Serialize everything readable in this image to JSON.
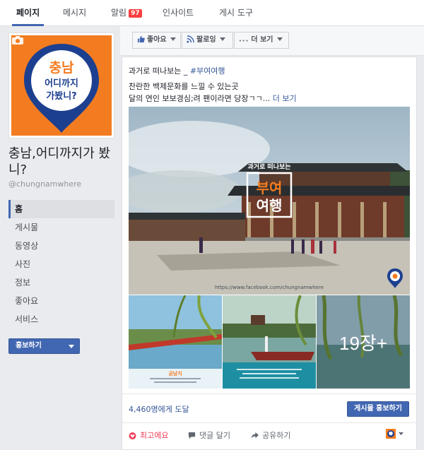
{
  "tabs": [
    {
      "label": "페이지",
      "active": true
    },
    {
      "label": "메시지",
      "active": false
    },
    {
      "label": "알림",
      "badge": "97",
      "active": false
    },
    {
      "label": "인사이트",
      "active": false
    },
    {
      "label": "게시 도구",
      "active": false
    }
  ],
  "sidebar": {
    "cover_text": [
      "충남",
      "어디까지",
      "가봤니?"
    ],
    "page_name": "충남,어디까지가 봤니?",
    "handle": "@chungnamwhere",
    "nav": [
      {
        "label": "홈",
        "active": true
      },
      {
        "label": "게시물",
        "active": false
      },
      {
        "label": "동영상",
        "active": false
      },
      {
        "label": "사진",
        "active": false
      },
      {
        "label": "정보",
        "active": false
      },
      {
        "label": "좋아요",
        "active": false
      },
      {
        "label": "서비스",
        "active": false
      }
    ],
    "promote_label": "홍보하기"
  },
  "actionbar": {
    "like": "좋아요",
    "follow": "팔로잉",
    "more": "더 보기"
  },
  "post": {
    "title_prefix": "과거로 떠나보는 _ ",
    "hashtag": "#부여여행",
    "line1": "찬란한 백제문화를 느낄 수 있는곳",
    "line2": "달의 연인 보보경심;려 팬이라면 당장ㄱㄱ...",
    "see_more": "더 보기",
    "image_overlay": {
      "subtitle": "과거로 떠나보는",
      "title_top": "부여",
      "title_bottom": "여행",
      "url": "https://www.facebook.com/chungnamwhere"
    },
    "thumb1_caption": "궁남지",
    "more_photos": "19장+",
    "reach": "4,460명에게 도달",
    "promote_post": "게시물 홍보하기",
    "actions": {
      "love": "최고에요",
      "comment": "댓글 달기",
      "share": "공유하기"
    }
  },
  "colors": {
    "brand_blue": "#4267b2",
    "link_blue": "#365899",
    "cover_orange": "#f47c20",
    "pin_navy": "#1d3f8f",
    "love_red": "#f33e58",
    "badge_red": "#fa3e3e"
  }
}
